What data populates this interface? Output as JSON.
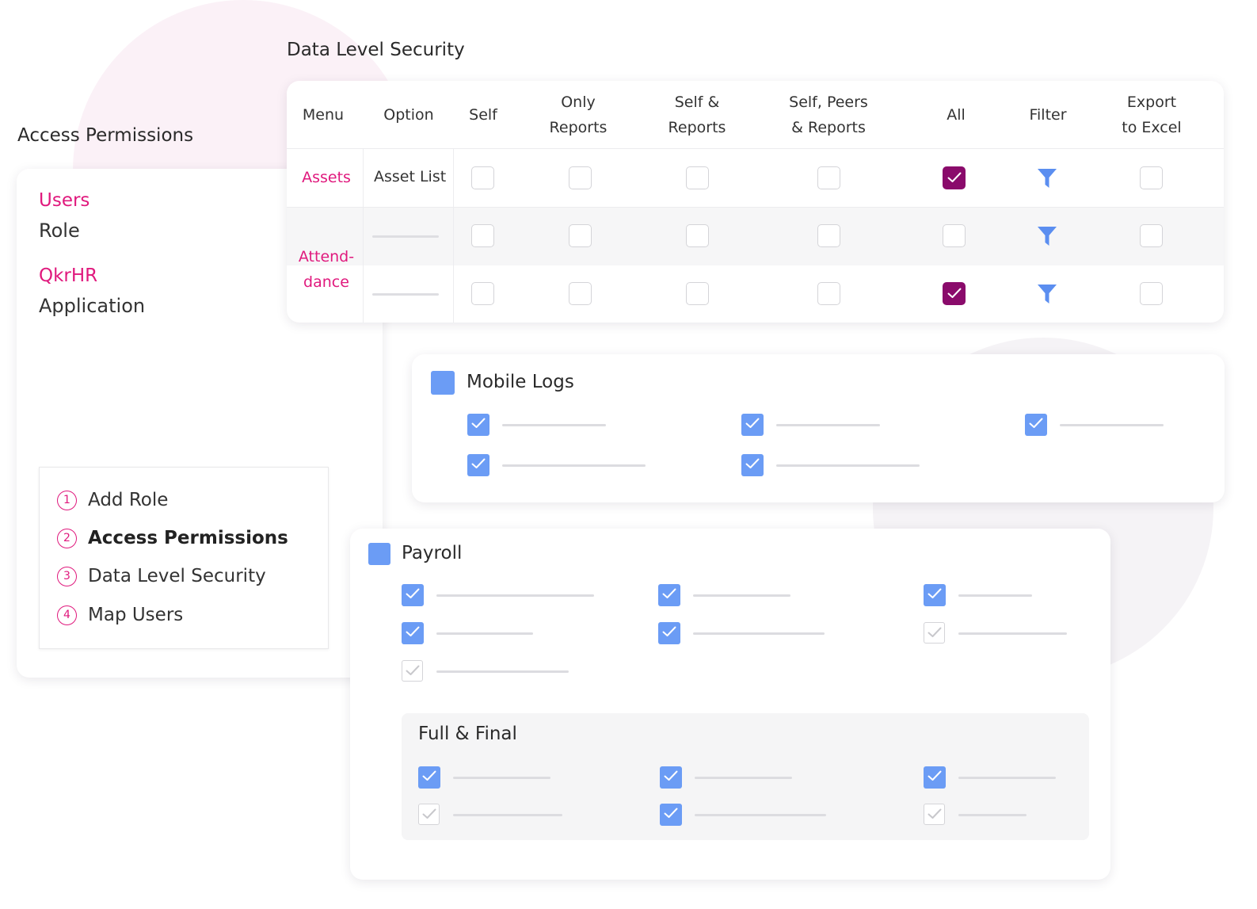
{
  "left_panel": {
    "title": "Access Permissions",
    "nav": [
      {
        "link": "Users",
        "sub": "Role"
      },
      {
        "link": "QkrHR",
        "sub": "Application"
      }
    ],
    "steps": [
      {
        "num": "1",
        "label": "Add Role",
        "active": false
      },
      {
        "num": "2",
        "label": "Access Permissions",
        "active": true
      },
      {
        "num": "3",
        "label": "Data Level Security",
        "active": false
      },
      {
        "num": "4",
        "label": "Map Users",
        "active": false
      }
    ]
  },
  "data_level_security": {
    "title": "Data Level Security",
    "columns": [
      "Menu",
      "Option",
      "Self",
      "Only Reports",
      "Self & Reports",
      "Self, Peers & Reports",
      "All",
      "Filter",
      "Export to Excel"
    ],
    "menus": [
      "Assets",
      "Attend-dance"
    ],
    "rows": [
      {
        "option": "Asset List",
        "self": false,
        "only_reports": false,
        "self_reports": false,
        "self_peers_reports": false,
        "all": true,
        "export": false
      },
      {
        "option": "",
        "self": false,
        "only_reports": false,
        "self_reports": false,
        "self_peers_reports": false,
        "all": false,
        "export": false
      },
      {
        "option": "",
        "self": false,
        "only_reports": false,
        "self_reports": false,
        "self_peers_reports": false,
        "all": true,
        "export": false
      }
    ]
  },
  "mobile_logs": {
    "title": "Mobile Logs",
    "checked": true,
    "items": [
      {
        "checked": true
      },
      {
        "checked": true
      },
      {
        "checked": true
      },
      {
        "checked": true
      },
      {
        "checked": true
      }
    ]
  },
  "payroll": {
    "title": "Payroll",
    "checked": true,
    "items": [
      {
        "checked": true
      },
      {
        "checked": true
      },
      {
        "checked": true
      },
      {
        "checked": true
      },
      {
        "checked": true
      },
      {
        "checked": false
      },
      {
        "checked": false
      }
    ],
    "full_final": {
      "title": "Full & Final",
      "items": [
        {
          "checked": true
        },
        {
          "checked": true
        },
        {
          "checked": true
        },
        {
          "checked": false
        },
        {
          "checked": true
        },
        {
          "checked": false
        }
      ]
    }
  },
  "colors": {
    "accent_pink": "#e0197d",
    "check_purple": "#8a0b6b",
    "check_blue": "#6b9cf5",
    "filter_blue": "#5b8ef0"
  }
}
